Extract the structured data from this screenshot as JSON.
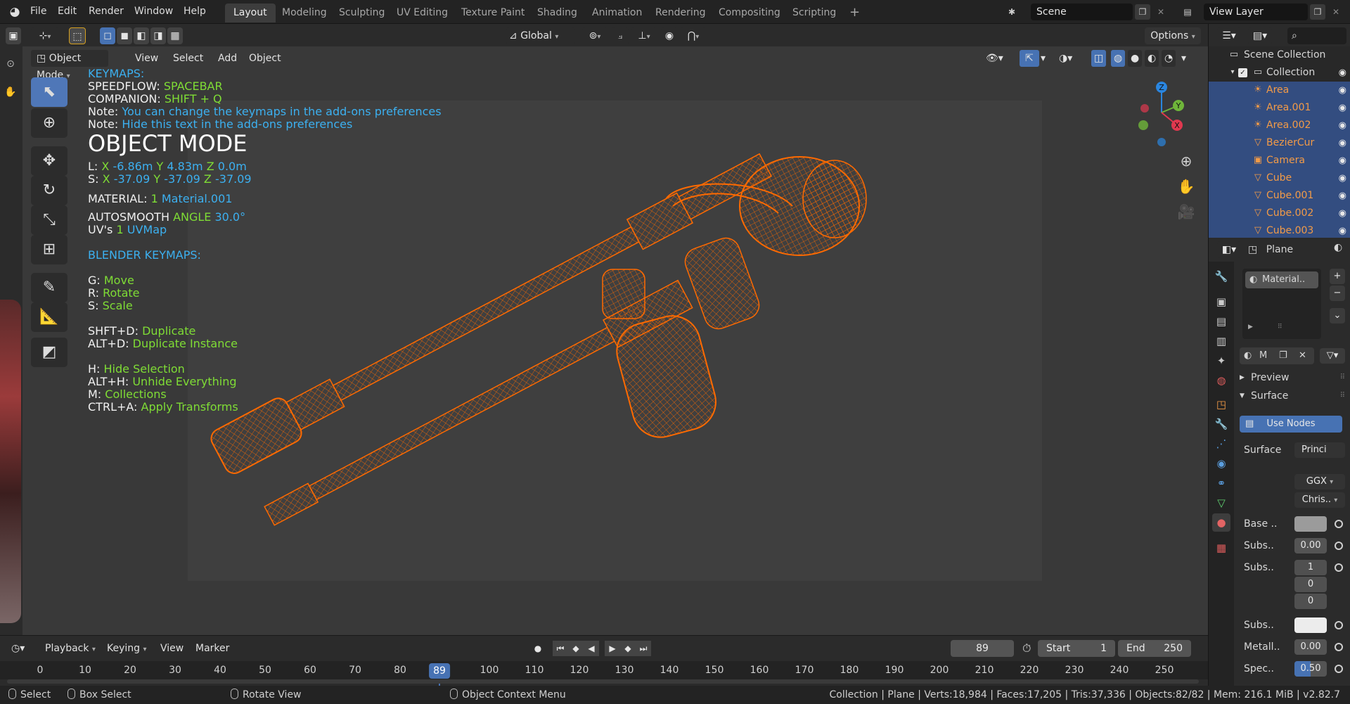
{
  "app": {
    "menus": [
      "File",
      "Edit",
      "Render",
      "Window",
      "Help"
    ],
    "workspaces": [
      "Layout",
      "Modeling",
      "Sculpting",
      "UV Editing",
      "Texture Paint",
      "Shading",
      "Animation",
      "Rendering",
      "Compositing",
      "Scripting"
    ],
    "add_workspace": "+",
    "scene": "Scene",
    "view_layer": "View Layer"
  },
  "header2": {
    "orientation": "Global",
    "options": "Options"
  },
  "viewport": {
    "mode": "Object Mode",
    "menus": [
      "View",
      "Select",
      "Add",
      "Object"
    ]
  },
  "overlay": {
    "keymaps_title": "KEYMAPS:",
    "speedflow_key": "SPEEDFLOW: ",
    "speedflow_val": "SPACEBAR",
    "companion_key": "COMPANION: ",
    "companion_val": "SHIFT + Q",
    "note_label": "Note: ",
    "note1": "You can change the keymaps in the add-ons preferences",
    "note2": "Hide this text in the add-ons preferences",
    "mode_title": "OBJECT MODE",
    "loc_label": "L:  ",
    "loc_x_axis": "X",
    "loc_x": "-6.86m",
    "loc_y_axis": "Y",
    "loc_y": "4.83m",
    "loc_z_axis": "Z",
    "loc_z": "0.0m",
    "scale_label": "S:  ",
    "scale_x_axis": "X",
    "scale_x": "-37.09",
    "scale_y_axis": "Y",
    "scale_y": "-37.09",
    "scale_z_axis": "Z",
    "scale_z": "-37.09",
    "material_label": "MATERIAL: ",
    "material_count": "1",
    "material_name": "Material.001",
    "autosmooth_label": "AUTOSMOOTH  ",
    "angle_label": "ANGLE ",
    "angle_val": "30.0°",
    "uv_label": "UV's ",
    "uv_count": "1",
    "uv_name": "UVMap",
    "blender_keymaps": "BLENDER KEYMAPS:",
    "g_key": "G: ",
    "g_val": "Move",
    "r_key": "R: ",
    "r_val": "Rotate",
    "s_key": "S: ",
    "s_val": "Scale",
    "shftd_key": "SHFT+D: ",
    "shftd_val": "Duplicate",
    "altd_key": "ALT+D: ",
    "altd_val": "Duplicate Instance",
    "h_key": "H: ",
    "h_val": "Hide Selection",
    "alth_key": "ALT+H: ",
    "alth_val": "Unhide Everything",
    "m_key": "M: ",
    "m_val": "Collections",
    "ctrla_key": "CTRL+A: ",
    "ctrla_val": "Apply Transforms"
  },
  "gizmo": {
    "z": "Z",
    "y": "Y",
    "x": "X"
  },
  "timeline": {
    "menus": [
      "Playback",
      "Keying",
      "View",
      "Marker"
    ],
    "current_frame": "89",
    "start_label": "Start",
    "start": "1",
    "end_label": "End",
    "end": "250",
    "ticks": [
      "0",
      "10",
      "20",
      "30",
      "40",
      "50",
      "60",
      "70",
      "80",
      "100",
      "110",
      "120",
      "130",
      "140",
      "150",
      "160",
      "170",
      "180",
      "190",
      "200",
      "210",
      "220",
      "230",
      "240",
      "250"
    ]
  },
  "statusbar": {
    "select": "Select",
    "box_select": "Box Select",
    "rotate_view": "Rotate View",
    "context_menu": "Object Context Menu",
    "stats": "Collection | Plane | Verts:18,984 | Faces:17,205 | Tris:37,336 | Objects:82/82 | Mem: 216.1 MiB | v2.82.7"
  },
  "outliner": {
    "root": "Scene Collection",
    "collection": "Collection",
    "items": [
      "Area",
      "Area.001",
      "Area.002",
      "BezierCur",
      "Camera",
      "Cube",
      "Cube.001",
      "Cube.002",
      "Cube.003"
    ]
  },
  "properties": {
    "object": "Plane",
    "material_slot": "Material..",
    "mat_name_short": "M",
    "preview": "Preview",
    "surface_panel": "Surface",
    "use_nodes": "Use Nodes",
    "surface_label": "Surface",
    "surface_value": "Princi",
    "distribution": "GGX",
    "subsurface_method": "Chris..",
    "base_label": "Base ..",
    "subs1_label": "Subs..",
    "subs1_value": "0.00",
    "subs2_label": "Subs..",
    "subs2_values": [
      "1",
      "0",
      "0"
    ],
    "subs3_label": "Subs..",
    "metal_label": "Metall..",
    "metal_value": "0.00",
    "spec_label": "Spec..",
    "spec_value": "0.50",
    "spec_fill": 0.5
  },
  "colors": {
    "accent": "#4772b3",
    "wire": "#ff6a00",
    "overlay_blue": "#3cb0f0",
    "overlay_green": "#7fdd35"
  }
}
